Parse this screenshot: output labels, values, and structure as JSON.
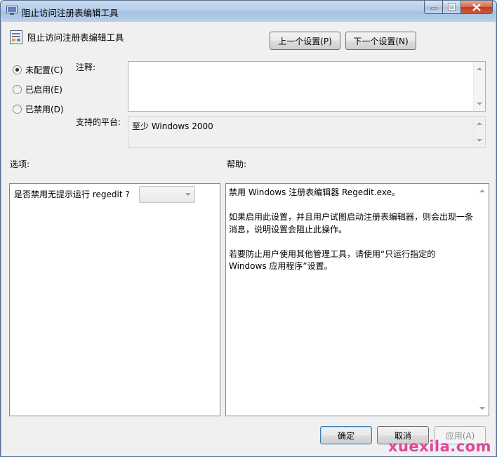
{
  "window": {
    "title": "阻止访问注册表编辑工具"
  },
  "header": {
    "policy_title": "阻止访问注册表编辑工具",
    "prev_button": "上一个设置(P)",
    "next_button": "下一个设置(N)"
  },
  "state": {
    "options": [
      {
        "label": "未配置(C)",
        "selected": true
      },
      {
        "label": "已启用(E)",
        "selected": false
      },
      {
        "label": "已禁用(D)",
        "selected": false
      }
    ]
  },
  "comment": {
    "label": "注释:",
    "value": ""
  },
  "platform": {
    "label": "支持的平台:",
    "value": "至少 Windows 2000"
  },
  "options_panel": {
    "heading": "选项:",
    "question": "是否禁用无提示运行 regedit ?",
    "selected_value": ""
  },
  "help_panel": {
    "heading": "帮助:",
    "paragraphs": [
      "禁用 Windows 注册表编辑器 Regedit.exe。",
      "如果启用此设置，并且用户试图启动注册表编辑器，则会出现一条消息，说明设置会阻止此操作。",
      "若要防止用户使用其他管理工具，请使用“只运行指定的 Windows 应用程序”设置。"
    ]
  },
  "footer": {
    "ok_button": "确定",
    "cancel_button": "取消",
    "apply_button": "应用(A)"
  },
  "watermark": "xuexila.com",
  "colors": {
    "titlebar": "#b5cde8",
    "dialog_bg": "#f0f0f0",
    "close_button": "#c23a1e",
    "watermark": "#e0479a"
  }
}
